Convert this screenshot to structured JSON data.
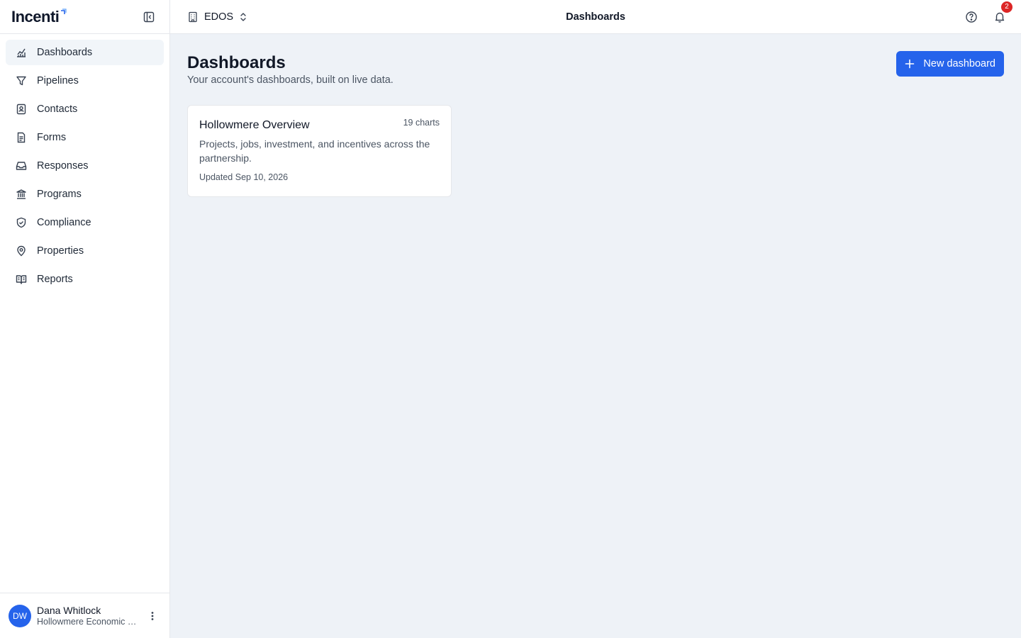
{
  "app": {
    "logo_text": "Incenti"
  },
  "sidebar": {
    "items": [
      {
        "label": "Dashboards",
        "icon": "chart-icon",
        "active": true
      },
      {
        "label": "Pipelines",
        "icon": "funnel-icon"
      },
      {
        "label": "Contacts",
        "icon": "contact-book-icon"
      },
      {
        "label": "Forms",
        "icon": "document-icon"
      },
      {
        "label": "Responses",
        "icon": "inbox-icon"
      },
      {
        "label": "Programs",
        "icon": "bank-icon"
      },
      {
        "label": "Compliance",
        "icon": "shield-check-icon"
      },
      {
        "label": "Properties",
        "icon": "map-pin-icon"
      },
      {
        "label": "Reports",
        "icon": "book-icon"
      }
    ],
    "user": {
      "initials": "DW",
      "name": "Dana Whitlock",
      "org": "Hollowmere Economic Development"
    }
  },
  "topbar": {
    "org_name": "EDOS",
    "title": "Dashboards",
    "notification_count": "2"
  },
  "page": {
    "title": "Dashboards",
    "subtitle": "Your account's dashboards, built on live data.",
    "new_button": "New dashboard"
  },
  "dashboards": [
    {
      "title": "Hollowmere Overview",
      "count": "19 charts",
      "description": "Projects, jobs, investment, and incentives across the partnership.",
      "updated": "Updated Sep 10, 2026"
    }
  ],
  "colors": {
    "accent": "#2563eb",
    "badge": "#dc2626",
    "background": "#eef2f7"
  }
}
